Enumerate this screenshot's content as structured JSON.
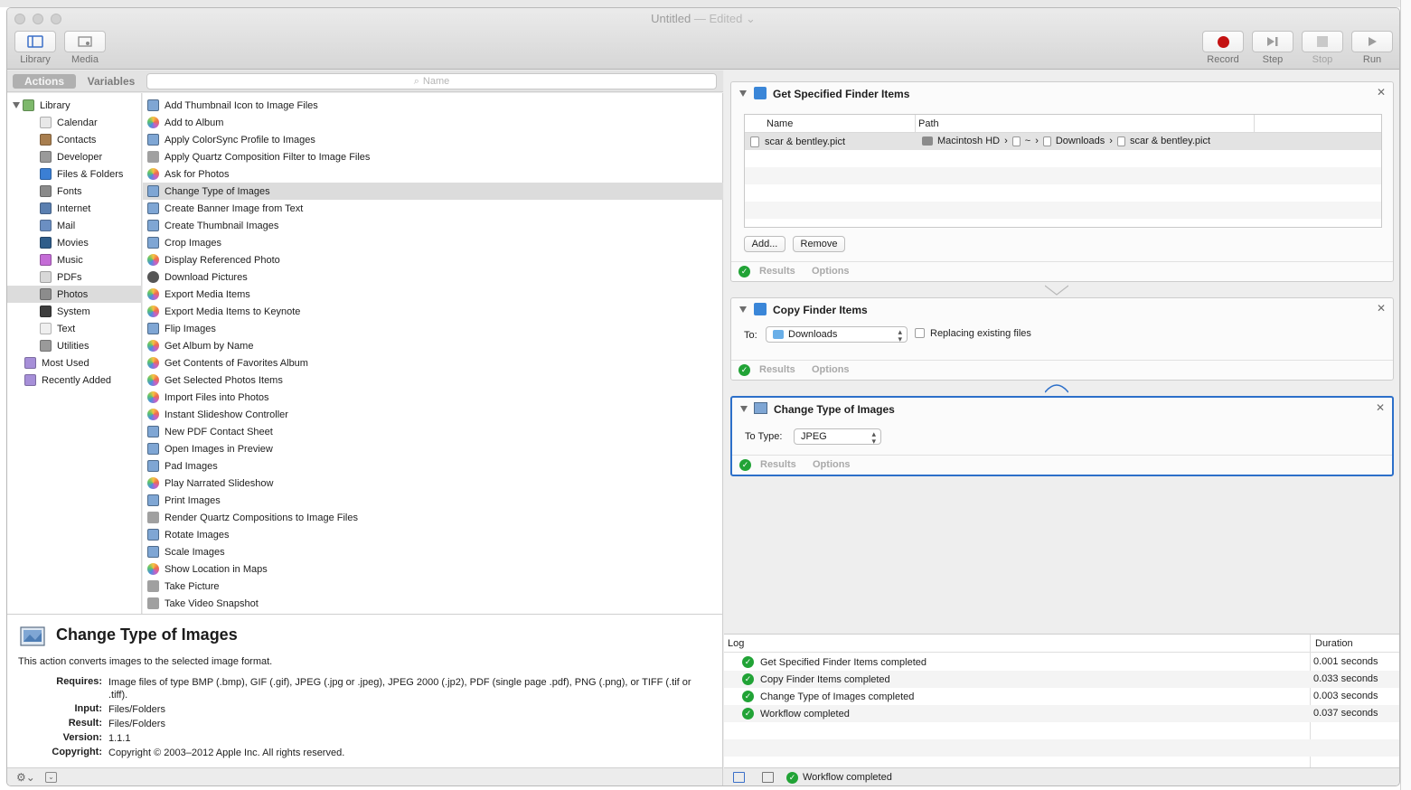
{
  "window": {
    "title": "Untitled",
    "edited": "— Edited"
  },
  "toolbar": {
    "library": "Library",
    "media": "Media",
    "record": "Record",
    "step": "Step",
    "stop": "Stop",
    "run": "Run"
  },
  "tabs": {
    "actions": "Actions",
    "variables": "Variables"
  },
  "search": {
    "placeholder": "Name"
  },
  "library": [
    {
      "label": "Library",
      "icon": "library-icon",
      "color": "#7db86b"
    },
    {
      "label": "Calendar",
      "icon": "calendar-icon",
      "color": "#e8e8e8"
    },
    {
      "label": "Contacts",
      "icon": "contacts-icon",
      "color": "#a87e4f"
    },
    {
      "label": "Developer",
      "icon": "hammer-icon",
      "color": "#9a9a9a"
    },
    {
      "label": "Files & Folders",
      "icon": "finder-icon",
      "color": "#3b7fd4"
    },
    {
      "label": "Fonts",
      "icon": "fonts-icon",
      "color": "#8a8a8a"
    },
    {
      "label": "Internet",
      "icon": "globe-icon",
      "color": "#5a7fb0"
    },
    {
      "label": "Mail",
      "icon": "mail-icon",
      "color": "#6b8fc2"
    },
    {
      "label": "Movies",
      "icon": "quicktime-icon",
      "color": "#2f5d8a"
    },
    {
      "label": "Music",
      "icon": "itunes-icon",
      "color": "#c46cd6"
    },
    {
      "label": "PDFs",
      "icon": "pdf-icon",
      "color": "#d8d8d8"
    },
    {
      "label": "Photos",
      "icon": "photos-icon",
      "color": "#8c8c8c"
    },
    {
      "label": "System",
      "icon": "system-icon",
      "color": "#3d3d3d"
    },
    {
      "label": "Text",
      "icon": "text-icon",
      "color": "#efefef"
    },
    {
      "label": "Utilities",
      "icon": "utilities-icon",
      "color": "#9a9a9a"
    },
    {
      "label": "Most Used",
      "icon": "smart-folder-icon",
      "color": "#a68fd8"
    },
    {
      "label": "Recently Added",
      "icon": "smart-folder-icon",
      "color": "#a68fd8"
    }
  ],
  "actions": [
    {
      "label": "Add Thumbnail Icon to Image Files",
      "icon": "preview-icon"
    },
    {
      "label": "Add to Album",
      "icon": "photos-app-icon"
    },
    {
      "label": "Apply ColorSync Profile to Images",
      "icon": "preview-icon"
    },
    {
      "label": "Apply Quartz Composition Filter to Image Files",
      "icon": "tools-icon"
    },
    {
      "label": "Ask for Photos",
      "icon": "photos-app-icon"
    },
    {
      "label": "Change Type of Images",
      "icon": "preview-icon"
    },
    {
      "label": "Create Banner Image from Text",
      "icon": "preview-icon"
    },
    {
      "label": "Create Thumbnail Images",
      "icon": "preview-icon"
    },
    {
      "label": "Crop Images",
      "icon": "preview-icon"
    },
    {
      "label": "Display Referenced Photo",
      "icon": "photos-app-icon"
    },
    {
      "label": "Download Pictures",
      "icon": "camera-icon"
    },
    {
      "label": "Export Media Items",
      "icon": "photos-app-icon"
    },
    {
      "label": "Export Media Items to Keynote",
      "icon": "photos-app-icon"
    },
    {
      "label": "Flip Images",
      "icon": "preview-icon"
    },
    {
      "label": "Get Album by Name",
      "icon": "photos-app-icon"
    },
    {
      "label": "Get Contents of Favorites Album",
      "icon": "photos-app-icon"
    },
    {
      "label": "Get Selected Photos Items",
      "icon": "photos-app-icon"
    },
    {
      "label": "Import Files into Photos",
      "icon": "photos-app-icon"
    },
    {
      "label": "Instant Slideshow Controller",
      "icon": "photos-app-icon"
    },
    {
      "label": "New PDF Contact Sheet",
      "icon": "preview-icon"
    },
    {
      "label": "Open Images in Preview",
      "icon": "preview-icon"
    },
    {
      "label": "Pad Images",
      "icon": "preview-icon"
    },
    {
      "label": "Play Narrated Slideshow",
      "icon": "photos-app-icon"
    },
    {
      "label": "Print Images",
      "icon": "preview-icon"
    },
    {
      "label": "Render Quartz Compositions to Image Files",
      "icon": "tools-icon"
    },
    {
      "label": "Rotate Images",
      "icon": "preview-icon"
    },
    {
      "label": "Scale Images",
      "icon": "preview-icon"
    },
    {
      "label": "Show Location in Maps",
      "icon": "photos-app-icon"
    },
    {
      "label": "Take Picture",
      "icon": "tools-icon"
    },
    {
      "label": "Take Video Snapshot",
      "icon": "tools-icon"
    }
  ],
  "description": {
    "title": "Change Type of Images",
    "summary": "This action converts images to the selected image format.",
    "requires_label": "Requires:",
    "requires": "Image files of type BMP (.bmp), GIF (.gif), JPEG (.jpg or .jpeg), JPEG 2000 (.jp2), PDF (single page .pdf), PNG (.png), or TIFF (.tif or .tiff).",
    "input_label": "Input:",
    "input": "Files/Folders",
    "result_label": "Result:",
    "result": "Files/Folders",
    "version_label": "Version:",
    "version": "1.1.1",
    "copyright_label": "Copyright:",
    "copyright": "Copyright © 2003–2012 Apple Inc.  All rights reserved."
  },
  "workflow": {
    "get_items": {
      "title": "Get Specified Finder Items",
      "col_name": "Name",
      "col_path": "Path",
      "file_name": "scar & bentley.pict",
      "path": [
        "Macintosh HD",
        "~",
        "Downloads",
        "scar & bentley.pict"
      ],
      "add": "Add...",
      "remove": "Remove"
    },
    "copy_items": {
      "title": "Copy Finder Items",
      "to_label": "To:",
      "to_value": "Downloads",
      "replace_label": "Replacing existing files"
    },
    "change_type": {
      "title": "Change Type of Images",
      "type_label": "To Type:",
      "type_value": "JPEG"
    },
    "results": "Results",
    "options": "Options"
  },
  "log": {
    "col_log": "Log",
    "col_duration": "Duration",
    "rows": [
      {
        "text": "Get Specified Finder Items completed",
        "duration": "0.001 seconds"
      },
      {
        "text": "Copy Finder Items completed",
        "duration": "0.033 seconds"
      },
      {
        "text": "Change Type of Images completed",
        "duration": "0.003 seconds"
      },
      {
        "text": "Workflow completed",
        "duration": "0.037 seconds"
      }
    ],
    "status": "Workflow completed"
  },
  "colors": {
    "accent": "#2c6fc9",
    "success": "#21a336",
    "record": "#c41212"
  }
}
